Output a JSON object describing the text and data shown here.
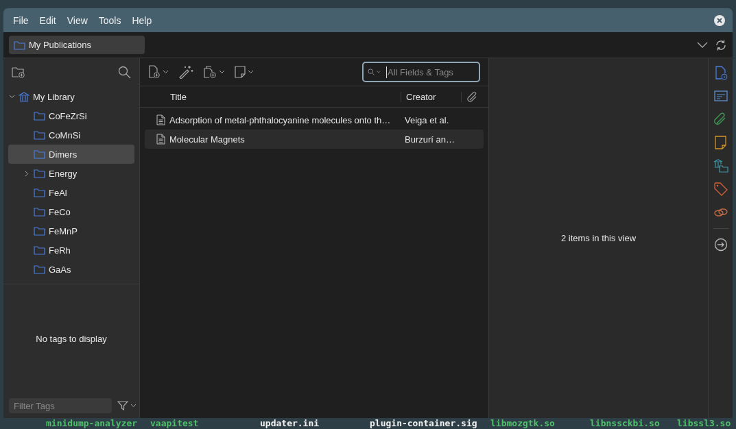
{
  "menu": [
    "File",
    "Edit",
    "View",
    "Tools",
    "Help"
  ],
  "collection_button": {
    "label": "My Publications"
  },
  "library": {
    "label": "My Library",
    "expanded": true,
    "children": [
      {
        "label": "CoFeZrSi",
        "selected": false,
        "expandable": false
      },
      {
        "label": "CoMnSi",
        "selected": false,
        "expandable": false
      },
      {
        "label": "Dimers",
        "selected": true,
        "expandable": false
      },
      {
        "label": "Energy",
        "selected": false,
        "expandable": true
      },
      {
        "label": "FeAl",
        "selected": false,
        "expandable": false
      },
      {
        "label": "FeCo",
        "selected": false,
        "expandable": false
      },
      {
        "label": "FeMnP",
        "selected": false,
        "expandable": false
      },
      {
        "label": "FeRh",
        "selected": false,
        "expandable": false
      },
      {
        "label": "GaAs",
        "selected": false,
        "expandable": false
      }
    ]
  },
  "tags": {
    "empty_message": "No tags to display",
    "filter_placeholder": "Filter Tags"
  },
  "search": {
    "placeholder": "All Fields & Tags"
  },
  "table": {
    "columns": [
      "Title",
      "Creator"
    ],
    "rows": [
      {
        "title": "Adsorption of metal-phthalocyanine molecules onto th…",
        "creator": "Veiga et al.",
        "selected": false
      },
      {
        "title": "Molecular Magnets",
        "creator": "Burzurí an…",
        "selected": true
      }
    ]
  },
  "item_pane": {
    "message": "2 items in this view"
  },
  "desktop_files": [
    {
      "name": "minidump-analyzer",
      "kind": "executable"
    },
    {
      "name": "vaapitest",
      "kind": "executable"
    },
    {
      "name": "updater.ini",
      "kind": "file"
    },
    {
      "name": "plugin-container.sig",
      "kind": "file"
    },
    {
      "name": "libmozgtk.so",
      "kind": "executable"
    },
    {
      "name": "libnssckbi.so",
      "kind": "executable"
    },
    {
      "name": "libssl3.so",
      "kind": "executable"
    }
  ]
}
